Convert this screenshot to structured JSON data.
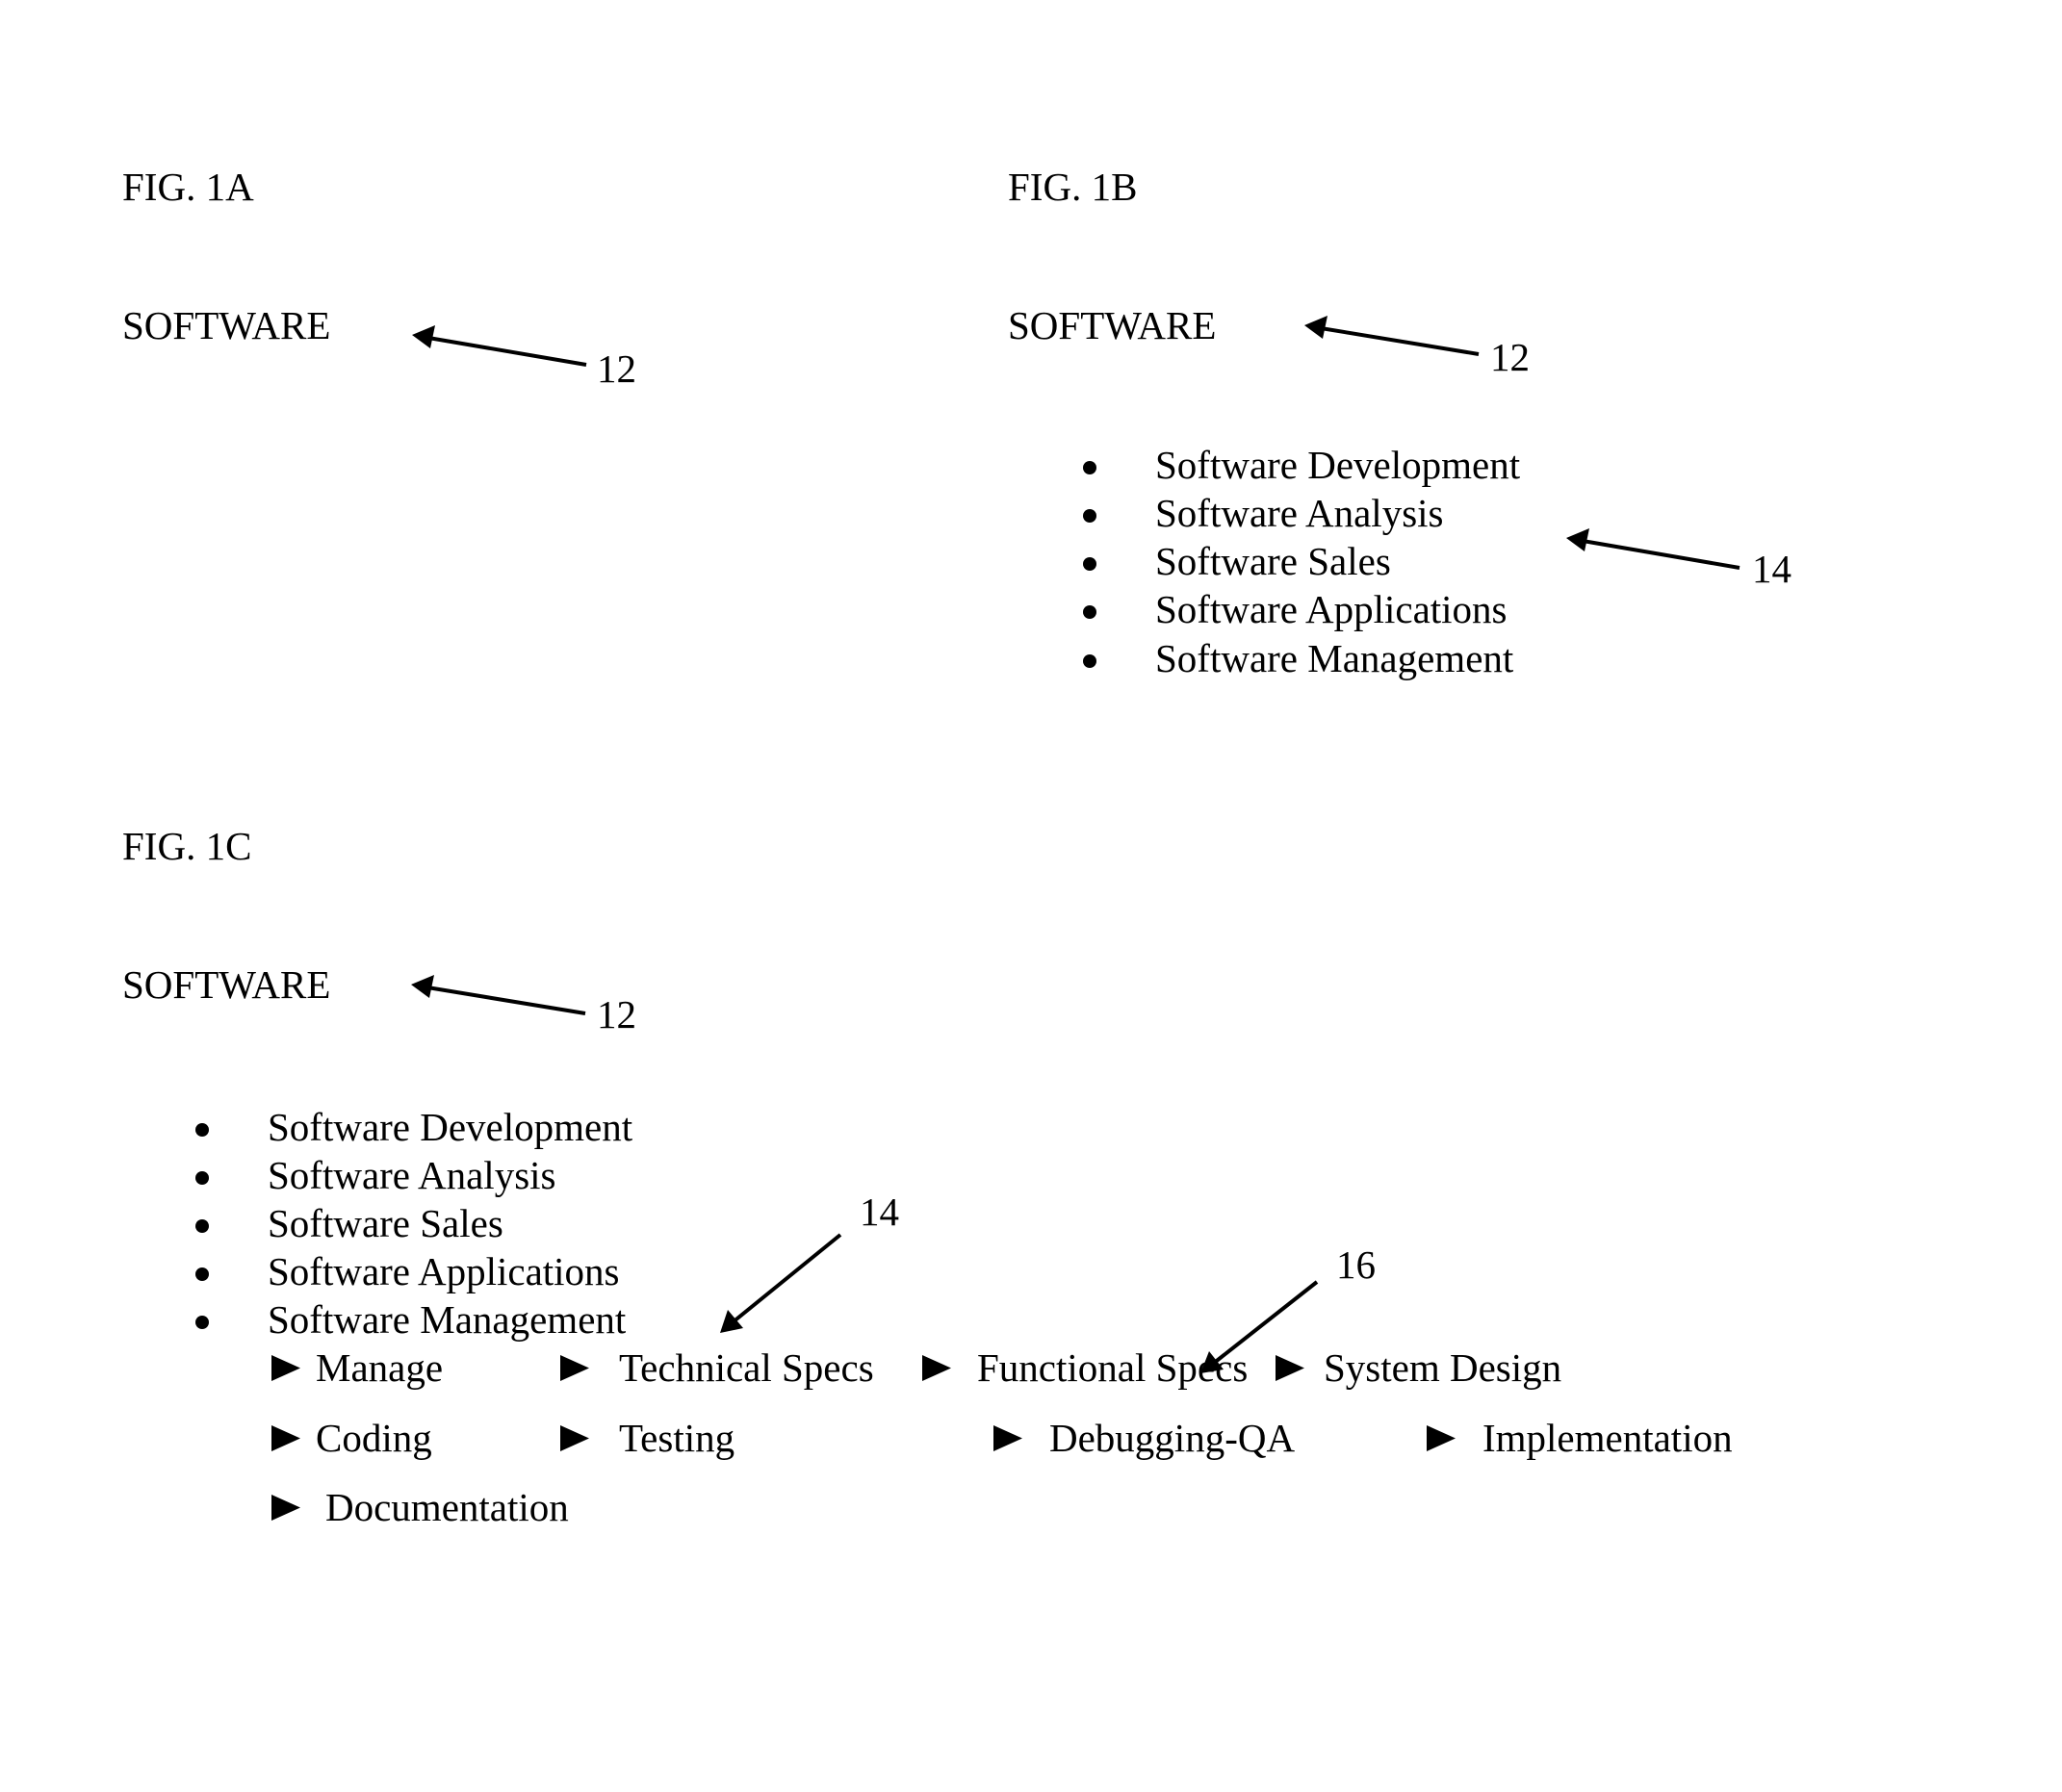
{
  "figures": {
    "fig_1a": {
      "label": "FIG. 1A",
      "root": "SOFTWARE",
      "root_ref": "12"
    },
    "fig_1b": {
      "label": "FIG. 1B",
      "root": "SOFTWARE",
      "root_ref": "12",
      "categories": [
        "Software Development",
        "Software Analysis",
        "Software Sales",
        "Software Applications",
        "Software Management"
      ],
      "categories_ref": "14"
    },
    "fig_1c": {
      "label": "FIG. 1C",
      "root": "SOFTWARE",
      "root_ref": "12",
      "categories": [
        "Software Development",
        "Software Analysis",
        "Software Sales",
        "Software Applications",
        "Software Management"
      ],
      "categories_ref": "14",
      "subcategories": [
        "Manage",
        "Technical Specs",
        "Functional Specs",
        "System Design",
        "Coding",
        "Testing",
        "Debugging-QA",
        "Implementation",
        "Documentation"
      ],
      "subcategories_ref": "16"
    }
  },
  "icons": {
    "category_marker": "bullet-dot",
    "subcategory_marker": "right-pointing-triangle",
    "reference_pointer": "arrow"
  },
  "colors": {
    "background": "#ffffff",
    "ink": "#000000"
  }
}
